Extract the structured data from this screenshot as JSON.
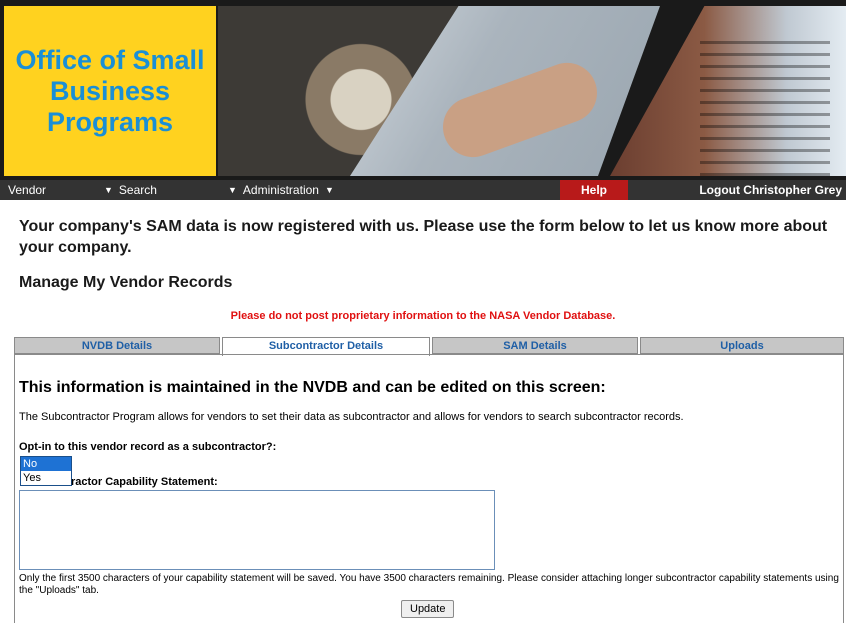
{
  "header": {
    "logo_text": "Office of Small\nBusiness\nPrograms"
  },
  "nav": {
    "vendor": "Vendor",
    "search": "Search",
    "administration": "Administration",
    "help": "Help",
    "logout": "Logout Christopher Grey"
  },
  "intro": "Your company's SAM data is now registered with us. Please use the form below to let us know more about your company.",
  "manage_title": "Manage My Vendor Records",
  "warning": "Please do not post proprietary information to the NASA Vendor Database.",
  "tabs": [
    {
      "label": "NVDB Details"
    },
    {
      "label": "Subcontractor Details"
    },
    {
      "label": "SAM Details"
    },
    {
      "label": "Uploads"
    }
  ],
  "active_tab": "Subcontractor Details",
  "panel": {
    "title": "This information is maintained in the NVDB and can be edited on this screen:",
    "description": "The Subcontractor Program allows for vendors to set their data as subcontractor and allows for vendors to search subcontractor records.",
    "optin_label": "Opt-in to this vendor record as a subcontractor?:",
    "optin_options": [
      "No",
      "Yes"
    ],
    "optin_selected": "No",
    "capability_label": "ractor Capability Statement:",
    "capability_value": "",
    "note": "Only the first 3500 characters of your capability statement will be saved. You have 3500 characters remaining. Please consider attaching longer subcontractor capability statements using the \"Uploads\" tab.",
    "update_label": "Update"
  },
  "colors": {
    "logo_bg": "#ffd21f",
    "logo_text": "#1a8fd6",
    "nav_bg": "#333333",
    "help_bg": "#b81a1a",
    "warning": "#e01010",
    "tab_text": "#1f5fa6",
    "selection": "#1e72d4"
  }
}
